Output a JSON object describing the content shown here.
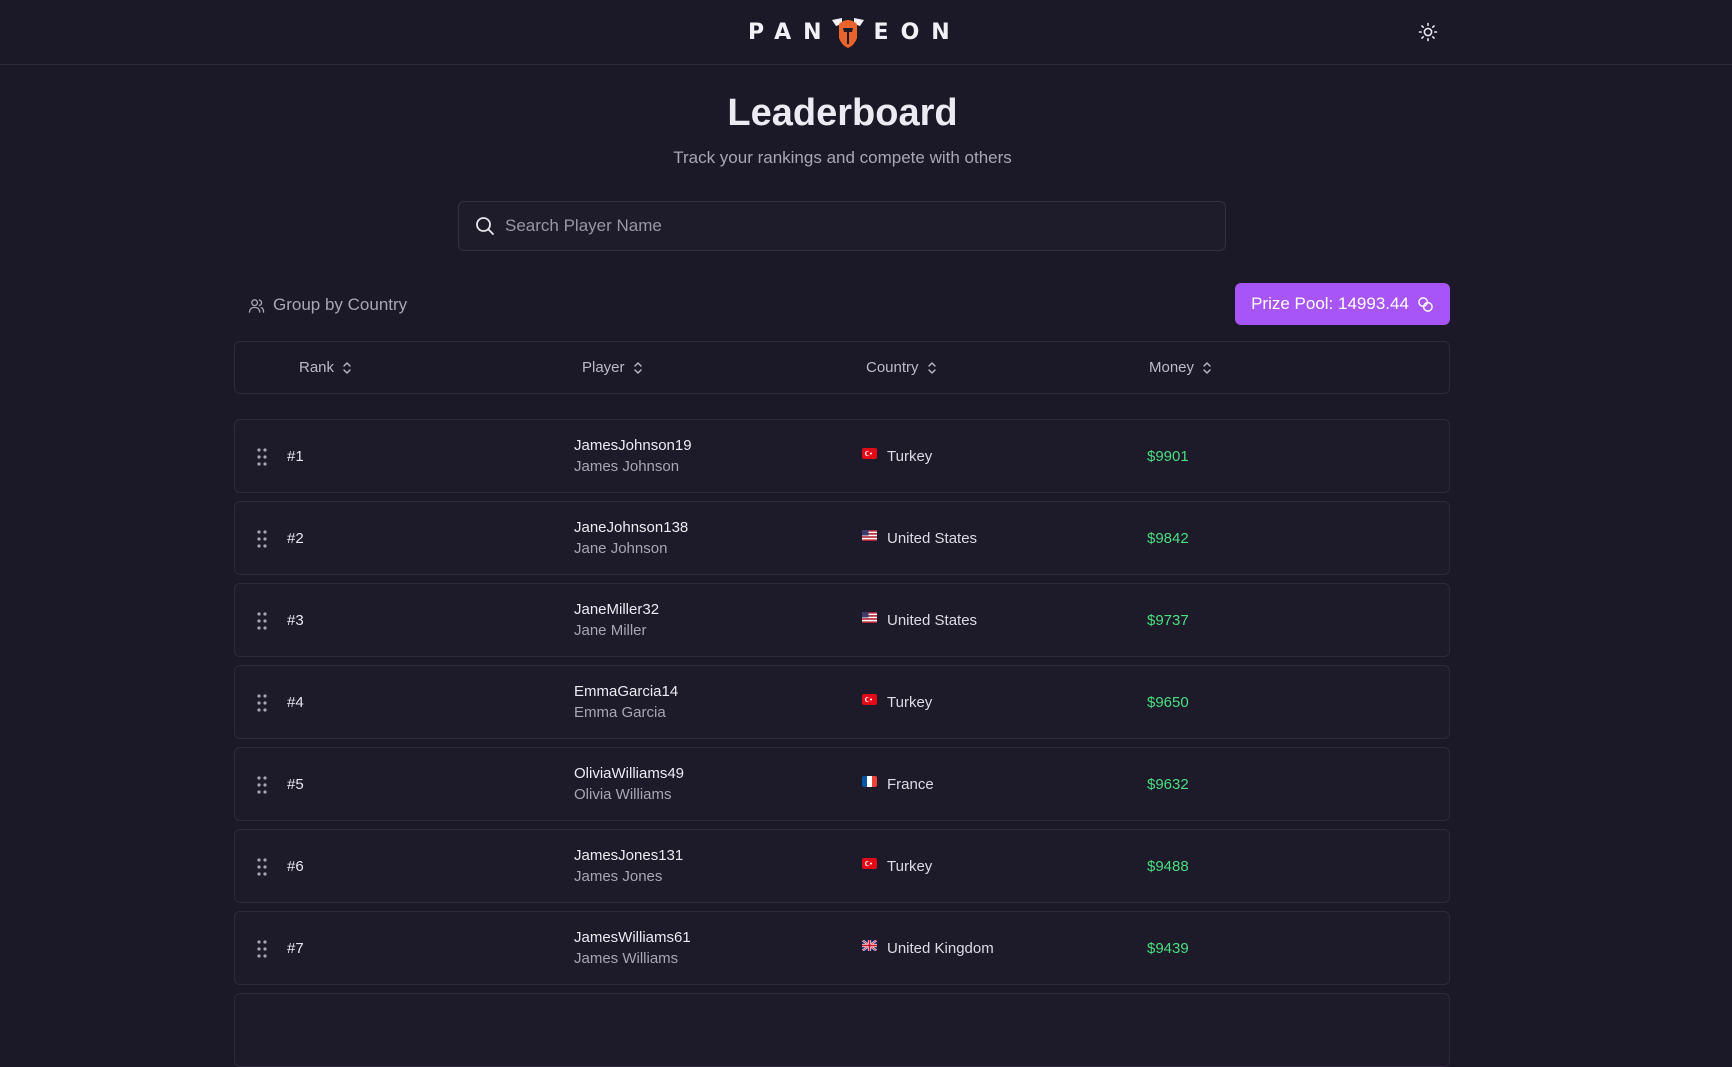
{
  "header": {
    "logo_left": "PAN",
    "logo_right": "EON",
    "helmet_icon": "helmet-logo-icon",
    "theme_icon": "sun-icon"
  },
  "page": {
    "title": "Leaderboard",
    "subtitle": "Track your rankings and compete with others"
  },
  "search": {
    "placeholder": "Search Player Name",
    "value": ""
  },
  "toolbar": {
    "group_label": "Group by Country",
    "prize_label": "Prize Pool: 14993.44"
  },
  "table": {
    "columns": [
      "Rank",
      "Player",
      "Country",
      "Money"
    ],
    "rows": [
      {
        "rank": "#1",
        "username": "JamesJohnson19",
        "name": "James Johnson",
        "country": "Turkey",
        "flag": "TR",
        "money": "$9901"
      },
      {
        "rank": "#2",
        "username": "JaneJohnson138",
        "name": "Jane Johnson",
        "country": "United States",
        "flag": "US",
        "money": "$9842"
      },
      {
        "rank": "#3",
        "username": "JaneMiller32",
        "name": "Jane Miller",
        "country": "United States",
        "flag": "US",
        "money": "$9737"
      },
      {
        "rank": "#4",
        "username": "EmmaGarcia14",
        "name": "Emma Garcia",
        "country": "Turkey",
        "flag": "TR",
        "money": "$9650"
      },
      {
        "rank": "#5",
        "username": "OliviaWilliams49",
        "name": "Olivia Williams",
        "country": "France",
        "flag": "FR",
        "money": "$9632"
      },
      {
        "rank": "#6",
        "username": "JamesJones131",
        "name": "James Jones",
        "country": "Turkey",
        "flag": "TR",
        "money": "$9488"
      },
      {
        "rank": "#7",
        "username": "JamesWilliams61",
        "name": "James Williams",
        "country": "United Kingdom",
        "flag": "GB",
        "money": "$9439"
      }
    ]
  },
  "colors": {
    "background": "#1b1827",
    "accent": "#a855f7",
    "money": "#4ade80",
    "logo_orange": "#e8642c"
  }
}
